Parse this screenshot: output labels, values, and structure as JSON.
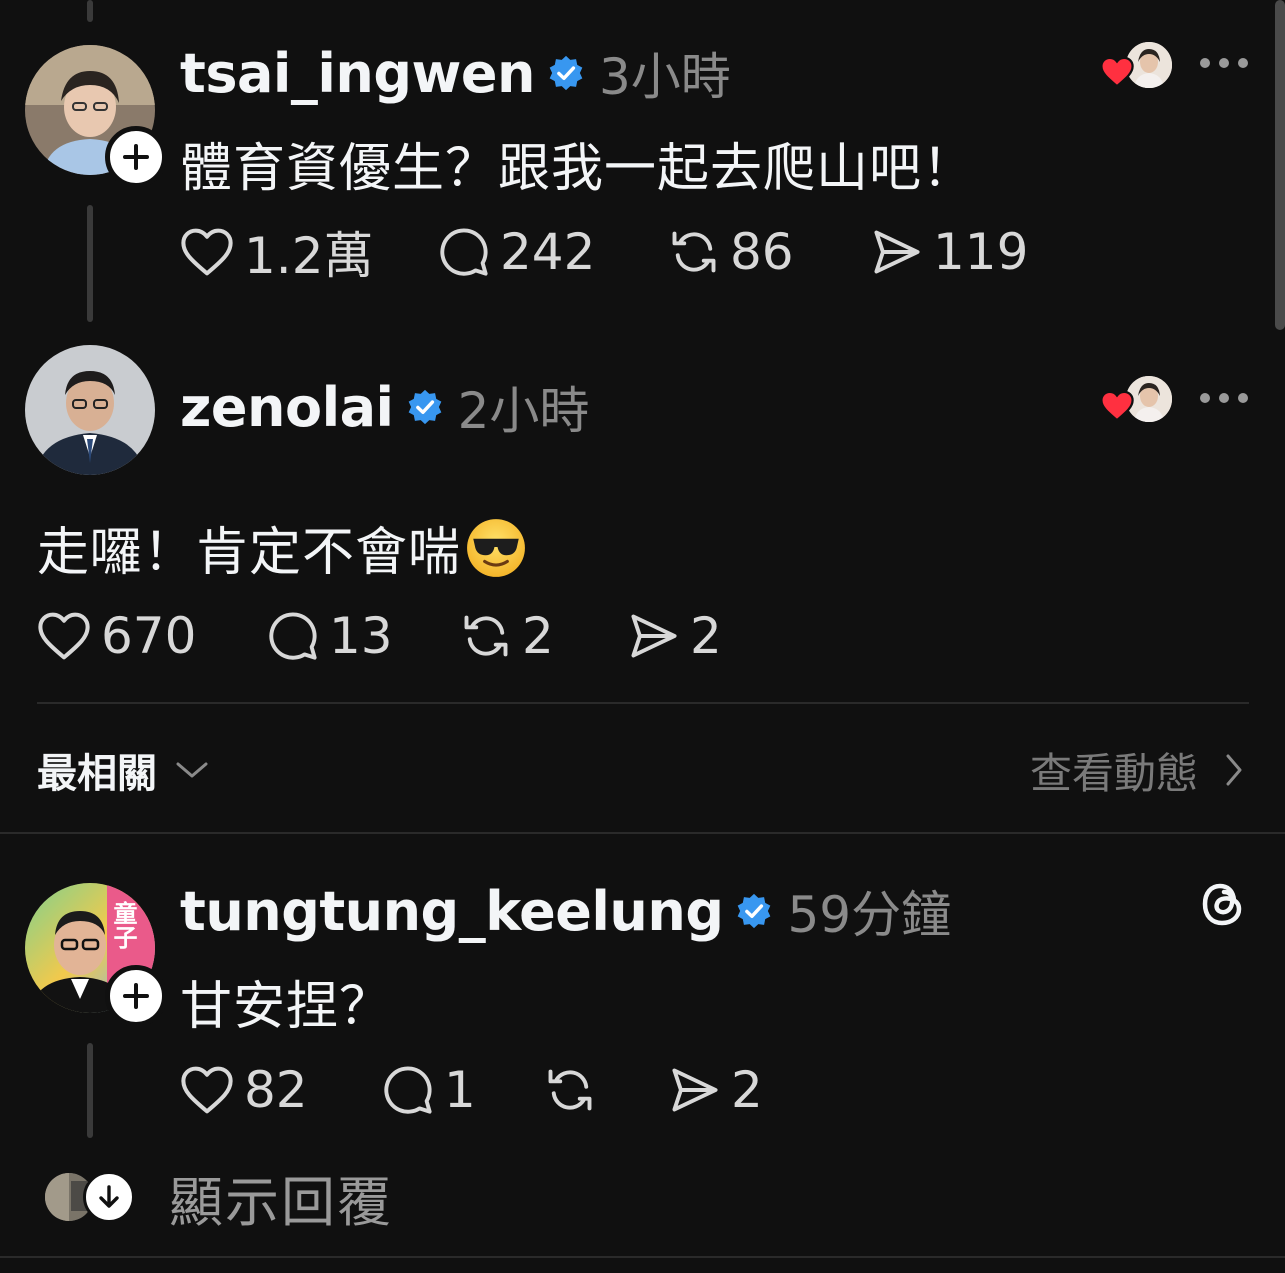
{
  "posts": [
    {
      "username": "tsai_ingwen",
      "time": "3小時",
      "text": "體育資優生？跟我一起去爬山吧！",
      "likes": "1.2萬",
      "comments": "242",
      "reposts": "86",
      "shares": "119"
    },
    {
      "username": "zenolai",
      "time": "2小時",
      "text": "走囉！肯定不會喘",
      "emoji": "😎",
      "likes": "670",
      "comments": "13",
      "reposts": "2",
      "shares": "2"
    },
    {
      "username": "tungtung_keelung",
      "time": "59分鐘",
      "text": "甘安捏？",
      "avatar_text": "童子",
      "likes": "82",
      "comments": "1",
      "reposts": "",
      "shares": "2"
    }
  ],
  "sort": {
    "label": "最相關",
    "activity_link": "查看動態"
  },
  "show_replies": "顯示回覆",
  "colors": {
    "background": "#101010",
    "verified": "#3897f0",
    "heart": "#ff3040",
    "muted": "#8a8a8a"
  }
}
